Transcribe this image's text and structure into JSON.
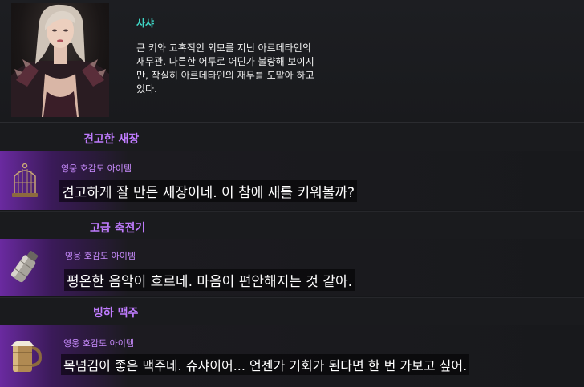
{
  "character": {
    "name": "사샤",
    "description_lines": [
      "큰 키와 고혹적인 외모를 지닌 아르데타인의",
      "재무관. 나른한 어투로 어딘가 불량해 보이지",
      "만, 착실히 아르데타인의 재무를 도맡아 하고",
      "있다."
    ],
    "portrait_icon": "character-portrait"
  },
  "items": [
    {
      "title": "견고한 새장",
      "grade": "영웅 호감도 아이템",
      "quote": "견고하게 잘 만든 새장이네. 이 참에 새를 키워볼까?",
      "icon": "birdcage-icon"
    },
    {
      "title": "고급 축전기",
      "grade": "영웅 호감도 아이템",
      "quote": "평온한 음악이 흐르네. 마음이 편안해지는 것 같아.",
      "icon": "capacitor-canister-icon"
    },
    {
      "title": "빙하 맥주",
      "grade": "영웅 호감도 아이템",
      "quote": "목넘김이 좋은 맥주네. 슈샤이어... 언젠가 기회가 된다면 한 번 가보고 싶어.",
      "icon": "beer-mug-icon"
    }
  ],
  "colors": {
    "name": "#3fd7c7",
    "title": "#c07cff",
    "grade": "#c98cff",
    "hero_purple": "#6a2aa0"
  }
}
